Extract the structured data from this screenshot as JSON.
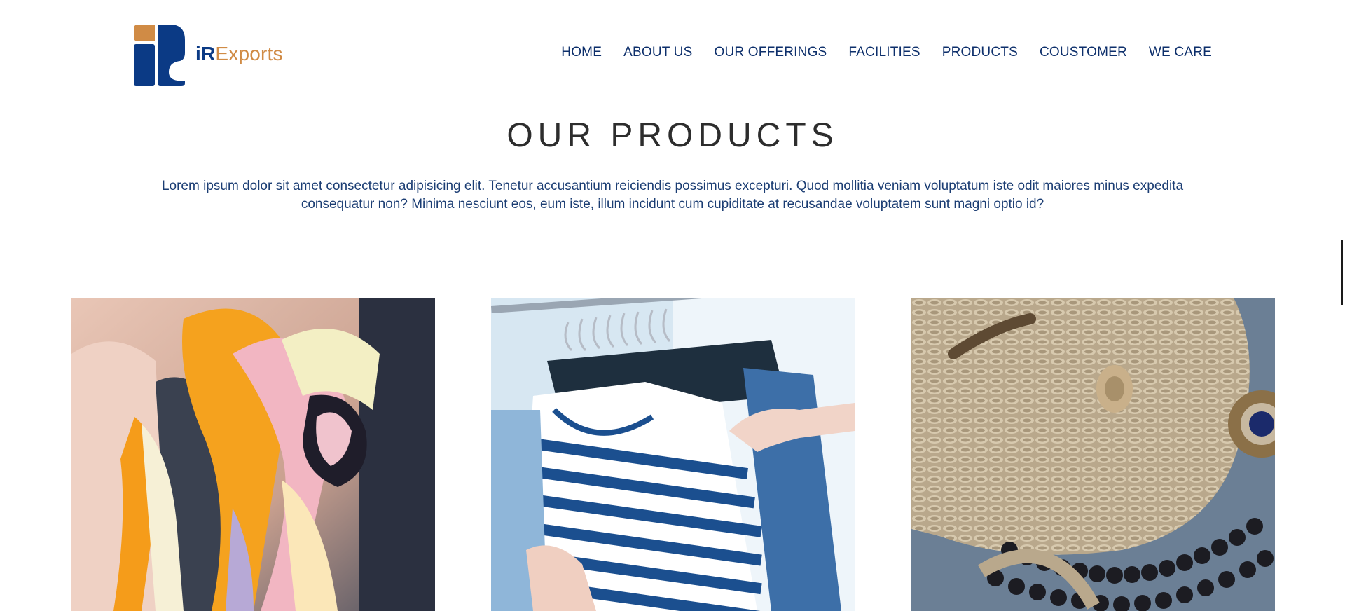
{
  "brand": {
    "name_prefix": "iR",
    "name_suffix": "Exports",
    "primary_color": "#0b3a85",
    "accent_color": "#d08b45"
  },
  "nav": {
    "items": [
      {
        "label": "HOME"
      },
      {
        "label": "ABOUT US"
      },
      {
        "label": "OUR OFFERINGS"
      },
      {
        "label": "FACILITIES"
      },
      {
        "label": "PRODUCTS"
      },
      {
        "label": "COUSTOMER"
      },
      {
        "label": "WE CARE"
      }
    ]
  },
  "products_section": {
    "title": "OUR PRODUCTS",
    "description": "Lorem ipsum dolor sit amet consectetur adipisicing elit. Tenetur accusantium reiciendis possimus excepturi. Quod mollitia veniam voluptatum iste odit maiores minus expedita consequatur non? Minima nesciunt eos, eum iste, illum incidunt cum cupiditate at recusandae voluptatem sunt magni optio id?",
    "tiles": [
      {
        "subject": "silk-scarves-photo"
      },
      {
        "subject": "striped-shirts-on-rack-photo"
      },
      {
        "subject": "woven-basket-and-beads-photo"
      }
    ]
  }
}
